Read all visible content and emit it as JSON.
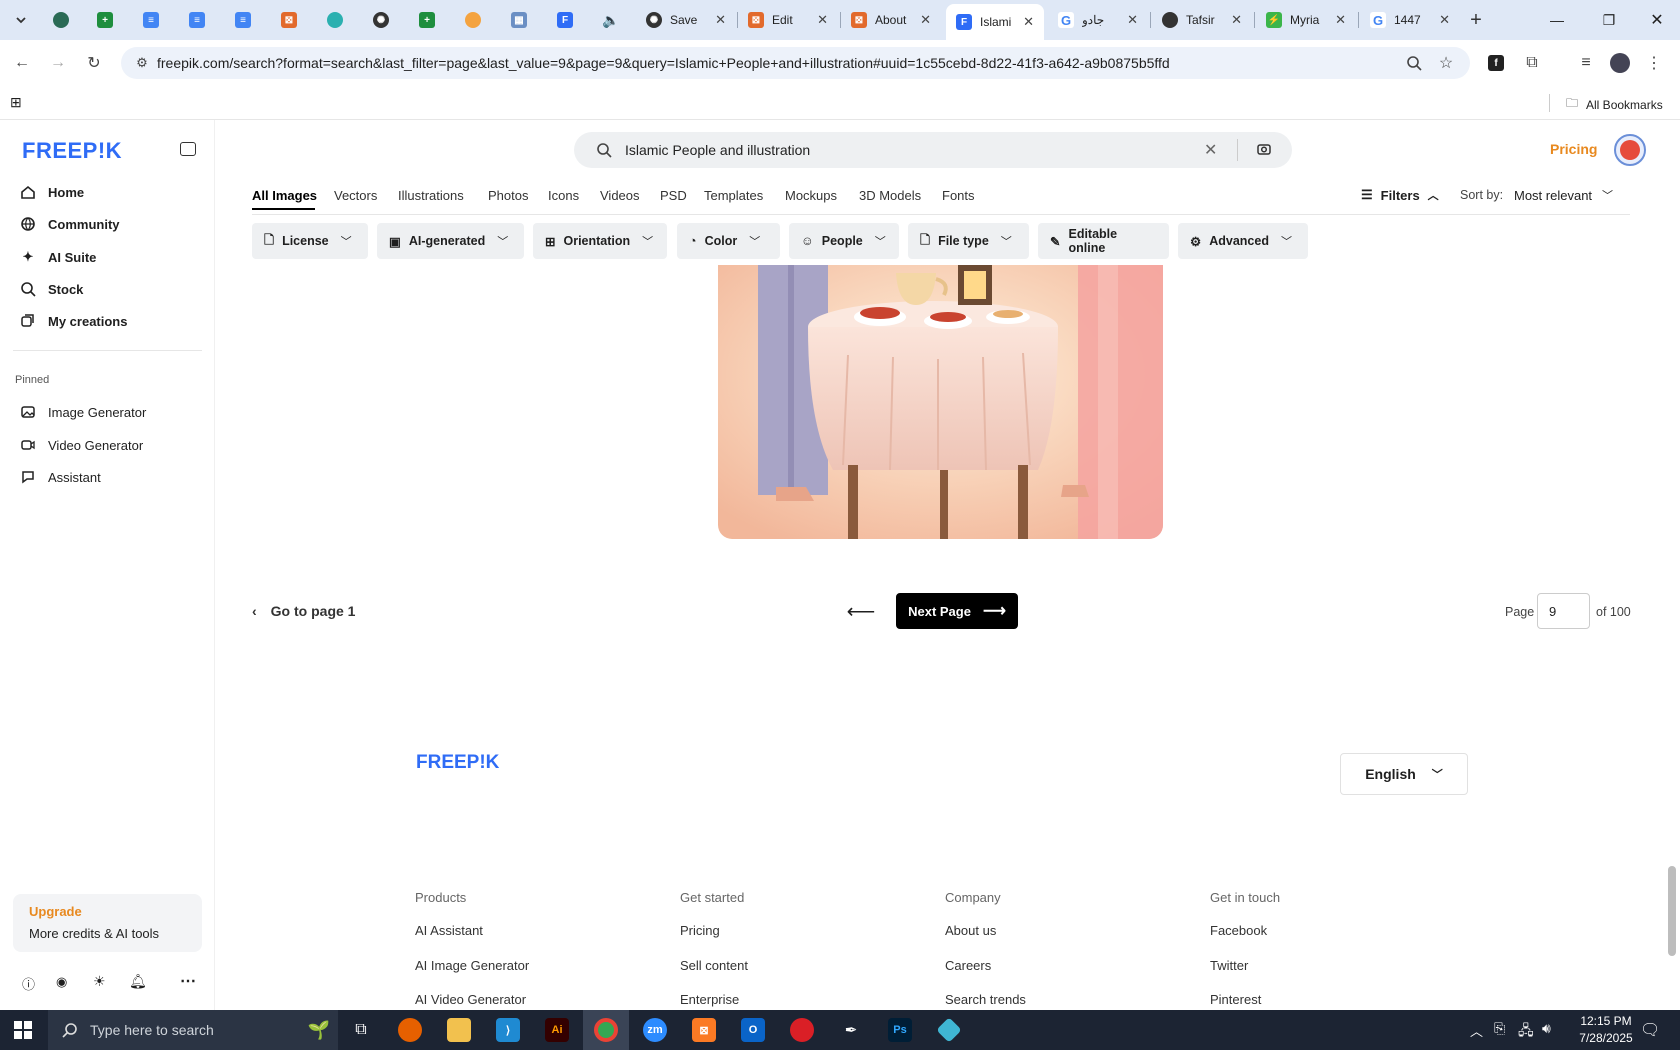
{
  "browser": {
    "tabs": [
      {
        "label": "Save",
        "active": false
      },
      {
        "label": "Edit",
        "active": false
      },
      {
        "label": "About",
        "active": false
      },
      {
        "label": "Islami",
        "active": true
      },
      {
        "label": "جادو",
        "active": false
      },
      {
        "label": "Tafsir",
        "active": false
      },
      {
        "label": "Myria",
        "active": false
      },
      {
        "label": "1447",
        "active": false
      }
    ],
    "url": "freepik.com/search?format=search&last_filter=page&last_value=9&page=9&query=Islamic+People+and+illustration#uuid=1c55cebd-8d22-41f3-a642-a9b0875b5ffd",
    "all_bookmarks": "All Bookmarks"
  },
  "sidebar": {
    "logo": "FREEP!K",
    "nav": [
      {
        "label": "Home"
      },
      {
        "label": "Community"
      },
      {
        "label": "AI Suite"
      },
      {
        "label": "Stock"
      },
      {
        "label": "My creations"
      }
    ],
    "pinned_title": "Pinned",
    "pinned": [
      {
        "label": "Image Generator"
      },
      {
        "label": "Video Generator"
      },
      {
        "label": "Assistant"
      }
    ],
    "upgrade": {
      "title": "Upgrade",
      "subtitle": "More credits & AI tools"
    }
  },
  "header": {
    "search_value": "Islamic People and illustration",
    "pricing": "Pricing"
  },
  "categories": [
    "All Images",
    "Vectors",
    "Illustrations",
    "Photos",
    "Icons",
    "Videos",
    "PSD",
    "Templates",
    "Mockups",
    "3D Models",
    "Fonts"
  ],
  "filters_label": "Filters",
  "sort": {
    "label": "Sort by:",
    "value": "Most relevant"
  },
  "chips": [
    "License",
    "AI-generated",
    "Orientation",
    "Color",
    "People",
    "File type",
    "Editable online",
    "Advanced"
  ],
  "pagination": {
    "goto_first": "Go to page 1",
    "next": "Next Page",
    "page_label": "Page",
    "current": "9",
    "of_total": "of 100"
  },
  "footer": {
    "logo": "FREEP!K",
    "language": "English",
    "columns": [
      {
        "title": "Products",
        "links": [
          "AI Assistant",
          "AI Image Generator",
          "AI Video Generator"
        ]
      },
      {
        "title": "Get started",
        "links": [
          "Pricing",
          "Sell content",
          "Enterprise"
        ]
      },
      {
        "title": "Company",
        "links": [
          "About us",
          "Careers",
          "Search trends"
        ]
      },
      {
        "title": "Get in touch",
        "links": [
          "Facebook",
          "Twitter",
          "Pinterest"
        ]
      }
    ]
  },
  "taskbar": {
    "search_placeholder": "Type here to search",
    "time": "12:15 PM",
    "date": "7/28/2025"
  },
  "colors": {
    "brand": "#2f6cf6",
    "accent_orange": "#e8891f",
    "taskbar": "#1c2433"
  }
}
